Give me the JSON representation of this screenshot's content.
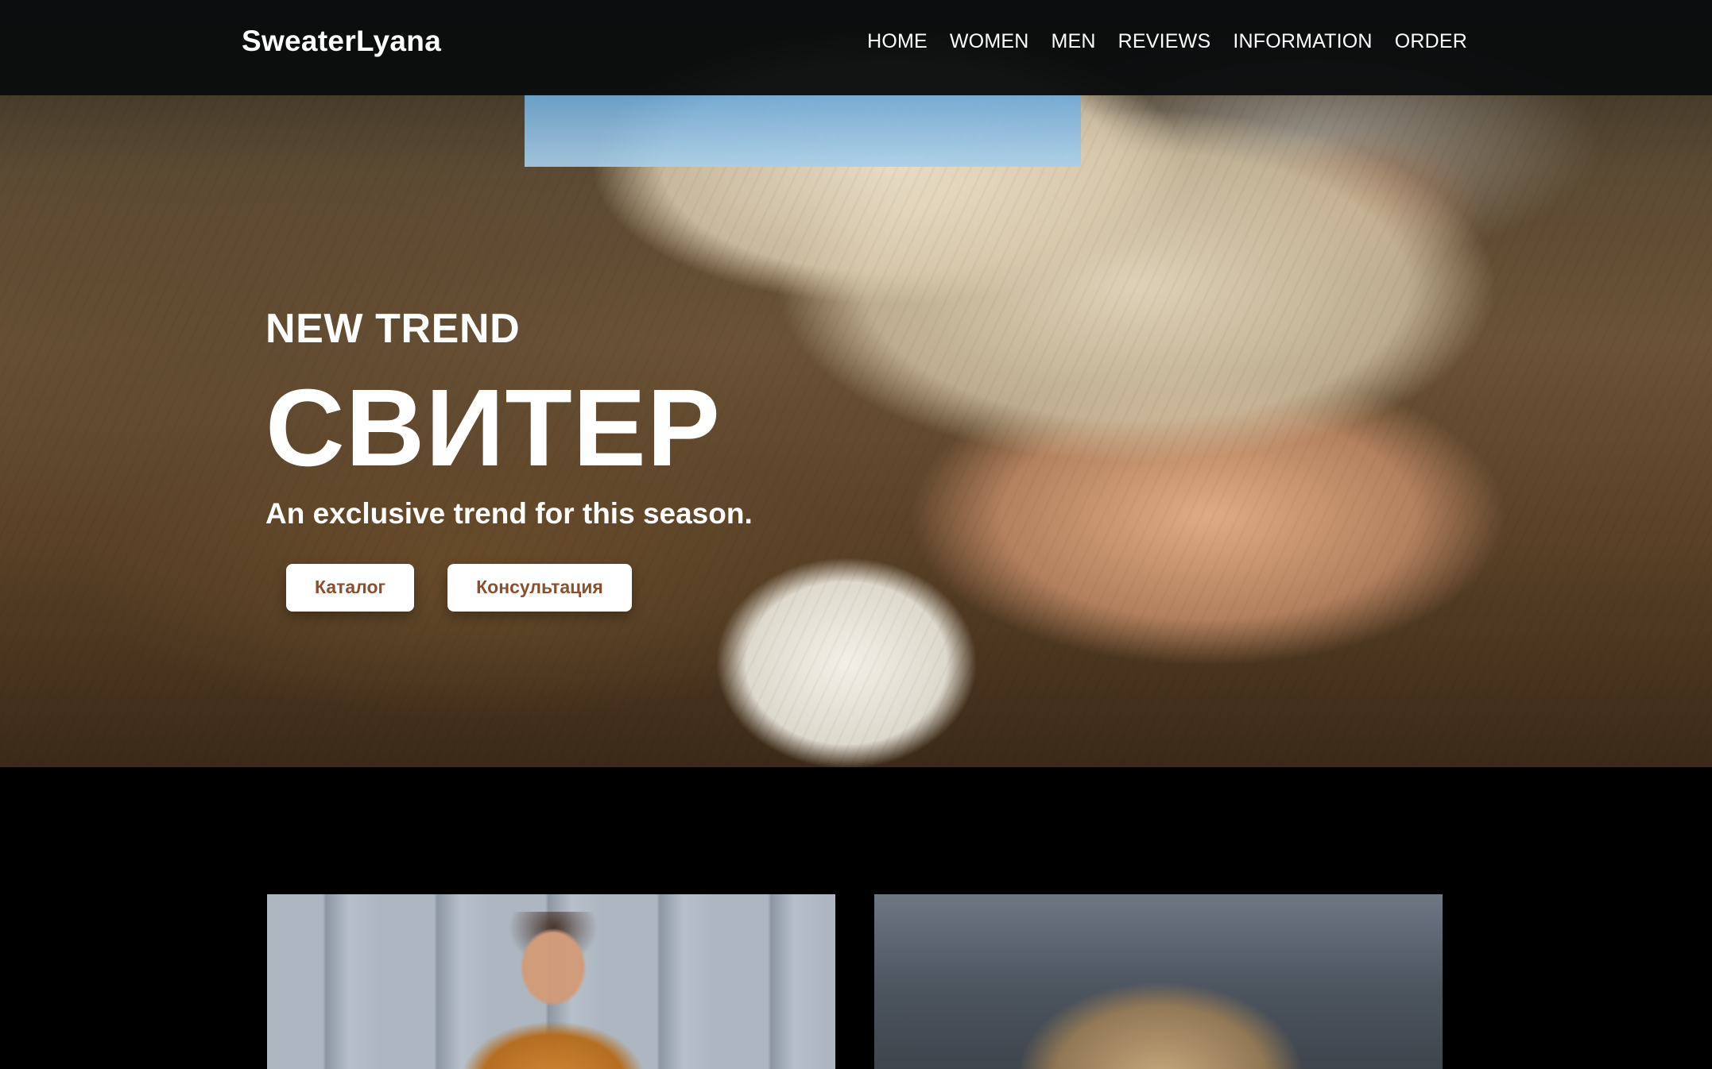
{
  "navbar": {
    "brand": "SweaterLyana",
    "links": [
      "HOME",
      "WOMEN",
      "MEN",
      "REVIEWS",
      "INFORMATION",
      "ORDER"
    ]
  },
  "hero": {
    "eyebrow": "NEW TREND",
    "headline": "СВИТЕР",
    "subheadline": "An exclusive trend for this season.",
    "buttons": {
      "catalog": "Каталог",
      "consultation": "Консультация"
    }
  },
  "theme": {
    "navbar_bg": "#0A0C0E",
    "page_bg": "#000000",
    "button_bg": "#FFFFFF",
    "button_text": "#8A4F2E"
  },
  "icons": {
    "hero_photo": "photo",
    "gallery_left_photo": "photo",
    "gallery_right_photo": "photo"
  }
}
